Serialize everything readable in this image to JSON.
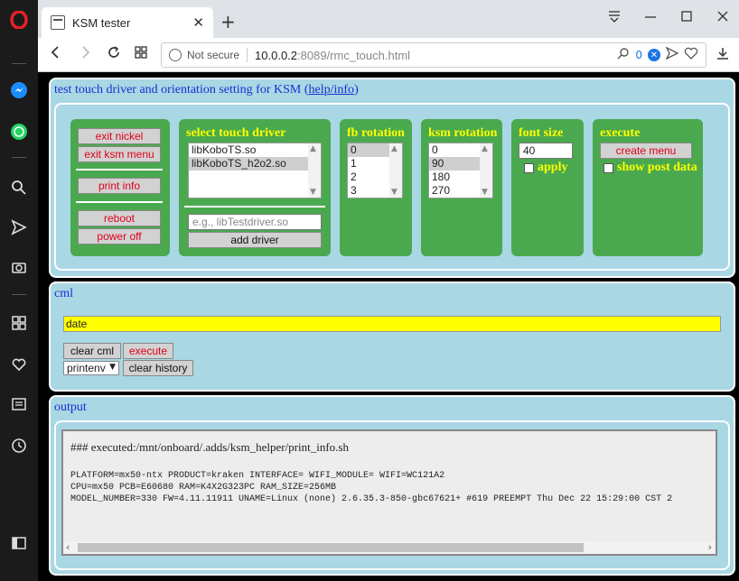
{
  "browser": {
    "tab_title": "KSM tester",
    "new_tab": "+",
    "not_secure": "Not secure",
    "url_host": "10.0.0.2",
    "url_rest": ":8089/rmc_touch.html",
    "tracker_count": "0"
  },
  "header": {
    "title": "test touch driver and orientation setting for KSM",
    "open_paren": "(",
    "help_link": "help/info",
    "close_paren": ")"
  },
  "actions": {
    "exit_nickel": "exit nickel",
    "exit_ksm_menu": "exit ksm menu",
    "print_info": "print info",
    "reboot": "reboot",
    "power_off": "power off"
  },
  "touch_driver": {
    "title": "select touch driver",
    "options": [
      "libKoboTS.so",
      "libKoboTS_h2o2.so"
    ],
    "selected_index": 1,
    "input_placeholder": "e.g., libTestdriver.so",
    "add_label": "add driver"
  },
  "fb_rotation": {
    "title": "fb rotation",
    "options": [
      "0",
      "1",
      "2",
      "3"
    ],
    "selected_index": 0
  },
  "ksm_rotation": {
    "title": "ksm rotation",
    "options": [
      "0",
      "90",
      "180",
      "270"
    ],
    "selected_index": 1
  },
  "font_size": {
    "title": "font size",
    "value": "40",
    "apply_label": "apply"
  },
  "execute_box": {
    "title": "execute",
    "create_menu": "create menu",
    "show_post_label": "show post data"
  },
  "cml": {
    "title": "cml",
    "value": "date",
    "clear_label": "clear cml",
    "execute_label": "execute",
    "history_selected": "printenv",
    "clear_history_label": "clear history"
  },
  "output": {
    "title": "output",
    "heading": "### executed:/mnt/onboard/.adds/ksm_helper/print_info.sh",
    "lines": [
      "PLATFORM=mx50-ntx PRODUCT=kraken INTERFACE= WIFI_MODULE= WIFI=WC121A2",
      "CPU=mx50 PCB=E60680 RAM=K4X2G323PC RAM_SIZE=256MB",
      "MODEL_NUMBER=330 FW=4.11.11911 UNAME=Linux (none) 2.6.35.3-850-gbc67621+ #619 PREEMPT Thu Dec 22 15:29:00 CST 2"
    ]
  }
}
